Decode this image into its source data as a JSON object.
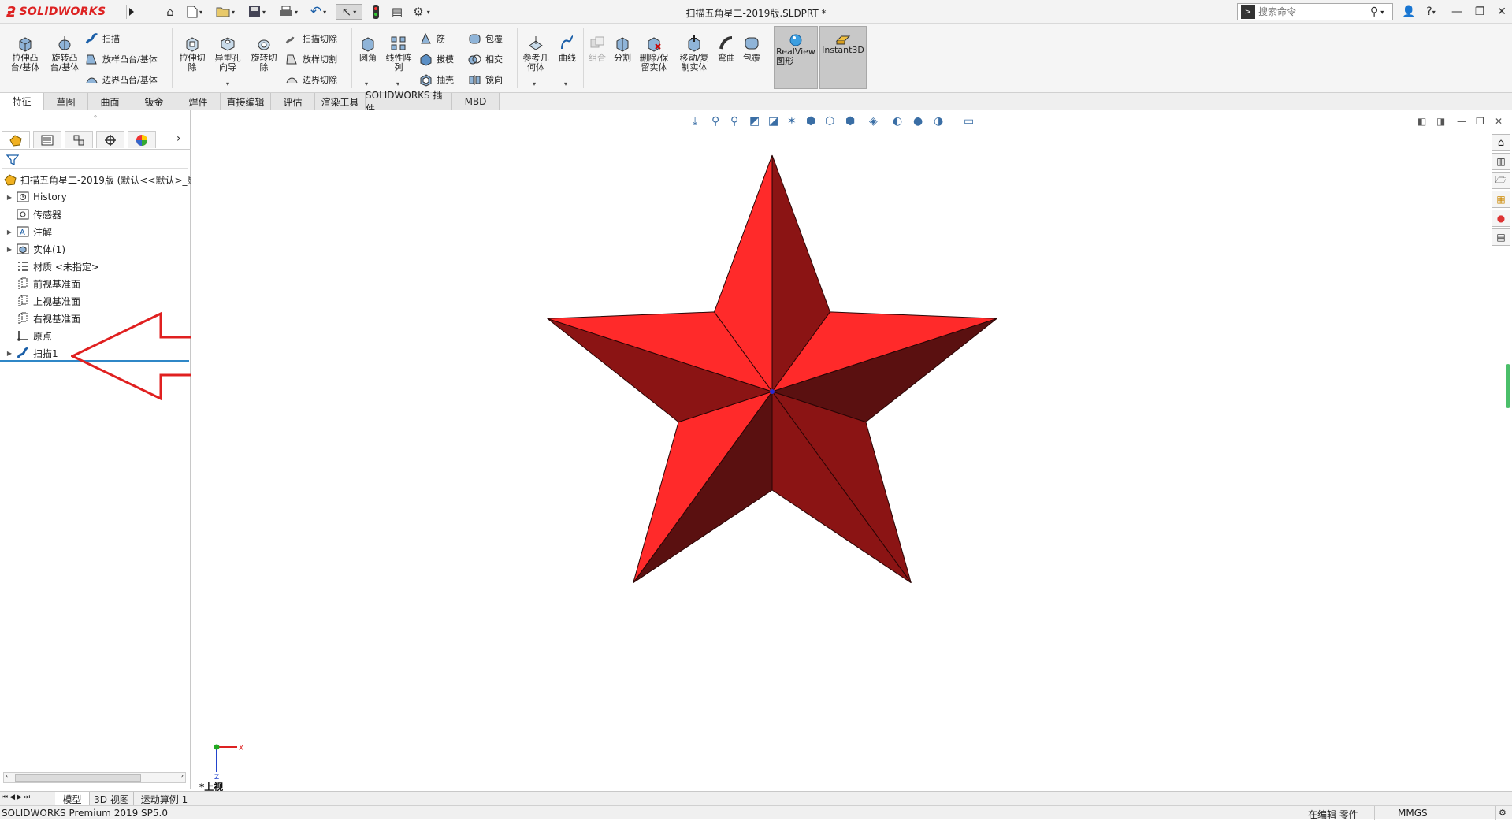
{
  "app": {
    "brand": "SOLIDWORKS",
    "document_title": "扫描五角星二-2019版.SLDPRT *",
    "search_placeholder": "搜索命令"
  },
  "quick_access": [
    {
      "name": "home-icon",
      "glyph": "⌂"
    },
    {
      "name": "new-file-icon",
      "glyph": "🗋"
    },
    {
      "name": "open-file-icon",
      "glyph": "📂"
    },
    {
      "name": "save-icon",
      "glyph": "💾"
    },
    {
      "name": "print-icon",
      "glyph": "🖶"
    },
    {
      "name": "undo-icon",
      "glyph": "↶"
    },
    {
      "name": "select-icon",
      "glyph": "↖"
    },
    {
      "name": "rebuild-icon",
      "glyph": "●"
    },
    {
      "name": "file-properties-icon",
      "glyph": "▤"
    },
    {
      "name": "options-icon",
      "glyph": "⚙"
    }
  ],
  "ribbon": {
    "extrude_boss": "拉伸凸\n台/基体",
    "revolve_boss": "旋转凸\n台/基体",
    "sweep": "扫描",
    "loft_boss": "放样凸台/基体",
    "boundary_boss": "边界凸台/基体",
    "extrude_cut": "拉伸切\n除",
    "hole_wizard": "异型孔\n向导",
    "revolve_cut": "旋转切\n除",
    "swept_cut": "扫描切除",
    "lofted_cut": "放样切割",
    "boundary_cut": "边界切除",
    "fillet": "圆角",
    "linear_pattern": "线性阵\n列",
    "rib": "筋",
    "draft": "拔模",
    "shell": "抽壳",
    "wrap": "包覆",
    "intersect": "相交",
    "mirror": "镜向",
    "ref_geometry": "参考几\n何体",
    "curves": "曲线",
    "combine": "组合",
    "split": "分割",
    "delete_keep_body": "删除/保\n留实体",
    "move_copy_body": "移动/复\n制实体",
    "flex": "弯曲",
    "wrap2": "包覆",
    "realview": "RealView\n图形",
    "instant3d": "Instant3D"
  },
  "tabs": [
    "特征",
    "草图",
    "曲面",
    "钣金",
    "焊件",
    "直接编辑",
    "评估",
    "渲染工具",
    "SOLIDWORKS 插件",
    "MBD"
  ],
  "tree": {
    "root": "扫描五角星二-2019版  (默认<<默认>_显",
    "items": [
      {
        "label": "History",
        "expand": true
      },
      {
        "label": "传感器",
        "expand": false
      },
      {
        "label": "注解",
        "expand": true
      },
      {
        "label": "实体(1)",
        "expand": true
      },
      {
        "label": "材质 <未指定>",
        "expand": false
      },
      {
        "label": "前视基准面",
        "expand": false
      },
      {
        "label": "上视基准面",
        "expand": false
      },
      {
        "label": "右视基准面",
        "expand": false
      },
      {
        "label": "原点",
        "expand": false
      },
      {
        "label": "扫描1",
        "expand": true
      }
    ]
  },
  "viewport": {
    "view_label": "*上视",
    "triad_x": "X",
    "triad_z": "Z"
  },
  "bottom_tabs": [
    "模型",
    "3D 视图",
    "运动算例 1"
  ],
  "status": {
    "left": "SOLIDWORKS Premium 2019 SP5.0",
    "editing": "在编辑 零件",
    "units": "MMGS"
  },
  "colors": {
    "star_light": "#ff2a2a",
    "star_dark": "#8b1414",
    "star_darker": "#5a1010",
    "arrow": "#e02020",
    "brand": "#d22222"
  }
}
